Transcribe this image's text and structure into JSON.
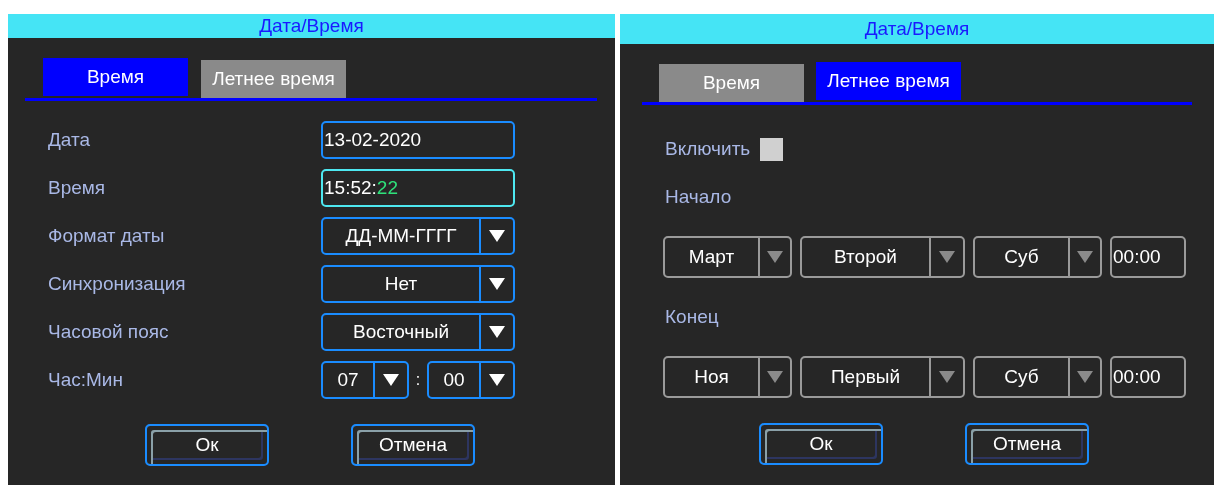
{
  "panels": [
    {
      "title": "Дата/Время",
      "tabs": [
        {
          "label": "Время",
          "selected": true
        },
        {
          "label": "Летнее время",
          "selected": false
        }
      ],
      "rows": [
        {
          "kind": "field",
          "label": "Дата",
          "focused": false,
          "parts": [
            {
              "text": "13-02-2020",
              "active": false
            }
          ]
        },
        {
          "kind": "field",
          "label": "Время",
          "focused": true,
          "parts": [
            {
              "text": "15:52:",
              "active": false
            },
            {
              "text": "22",
              "active": true
            }
          ]
        },
        {
          "kind": "select",
          "label": "Формат даты",
          "value": "ДД-ММ-ГГГГ"
        },
        {
          "kind": "select",
          "label": "Синхронизация",
          "value": "Нет"
        },
        {
          "kind": "select",
          "label": "Часовой пояс",
          "value": "Восточный"
        },
        {
          "kind": "hour_min",
          "label": "Час:Мин",
          "hour": "07",
          "separator": ":",
          "minute": "00"
        }
      ],
      "buttons": [
        "Ок",
        "Отмена"
      ]
    },
    {
      "title": "Дата/Время",
      "tabs": [
        {
          "label": "Время",
          "selected": false
        },
        {
          "label": "Летнее время",
          "selected": true
        }
      ],
      "rows": [
        {
          "kind": "checkbox",
          "label": "Включить",
          "checked": false
        },
        {
          "kind": "heading",
          "label": "Начало"
        },
        {
          "kind": "group",
          "items": [
            {
              "kind": "select",
              "value": "Март",
              "disabled": true
            },
            {
              "kind": "select",
              "value": "Второй",
              "disabled": true
            },
            {
              "kind": "select",
              "value": "Суб",
              "disabled": true
            },
            {
              "kind": "time",
              "value": "00:00",
              "disabled": true
            }
          ]
        },
        {
          "kind": "heading",
          "label": "Конец"
        },
        {
          "kind": "group",
          "items": [
            {
              "kind": "select",
              "value": "Ноя",
              "disabled": true
            },
            {
              "kind": "select",
              "value": "Первый",
              "disabled": true
            },
            {
              "kind": "select",
              "value": "Суб",
              "disabled": true
            },
            {
              "kind": "time",
              "value": "00:00",
              "disabled": true
            }
          ]
        }
      ],
      "buttons": [
        "Ок",
        "Отмена"
      ]
    }
  ]
}
